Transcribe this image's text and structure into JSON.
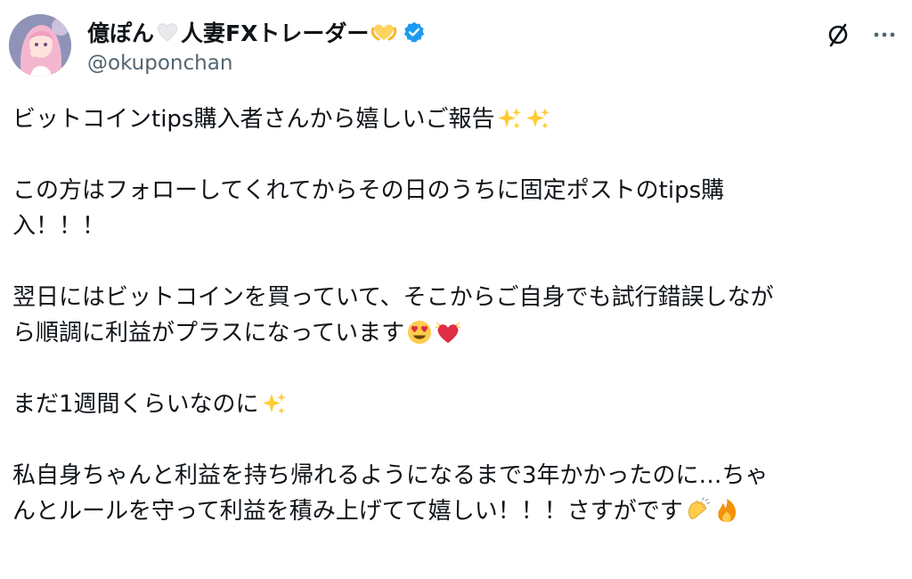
{
  "post": {
    "author": {
      "name_part1": "億ぽん",
      "name_part2": "人妻FXトレーダー",
      "handle": "@okuponchan",
      "verified": true
    },
    "paragraphs": [
      {
        "lines": [
          "ビットコインtips購入者さんから嬉しいご報告"
        ],
        "trailing_emojis": [
          "sparkles-icon",
          "sparkles-icon"
        ]
      },
      {
        "lines": [
          "この方はフォローしてくれてからその日のうちに固定ポストのtips購",
          "入！！！"
        ],
        "trailing_emojis": []
      },
      {
        "lines": [
          "翌日にはビットコインを買っていて、そこからご自身でも試行錯誤しなが",
          "ら順調に利益がプラスになっています"
        ],
        "trailing_emojis": [
          "heart-eyes-emoji",
          "beating-heart-emoji"
        ]
      },
      {
        "lines": [
          "まだ1週間くらいなのに"
        ],
        "trailing_emojis": [
          "sparkles-icon"
        ]
      },
      {
        "lines": [
          "私自身ちゃんと利益を持ち帰れるようになるまで3年かかったのに…ちゃ",
          "んとルールを守って利益を積み上げてて嬉しい！！！さすがです"
        ],
        "trailing_emojis": [
          "clapping-hands-emoji",
          "fire-emoji"
        ]
      }
    ]
  },
  "colors": {
    "text": "#0f1419",
    "secondary": "#536471",
    "verified": "#1d9bf0"
  }
}
